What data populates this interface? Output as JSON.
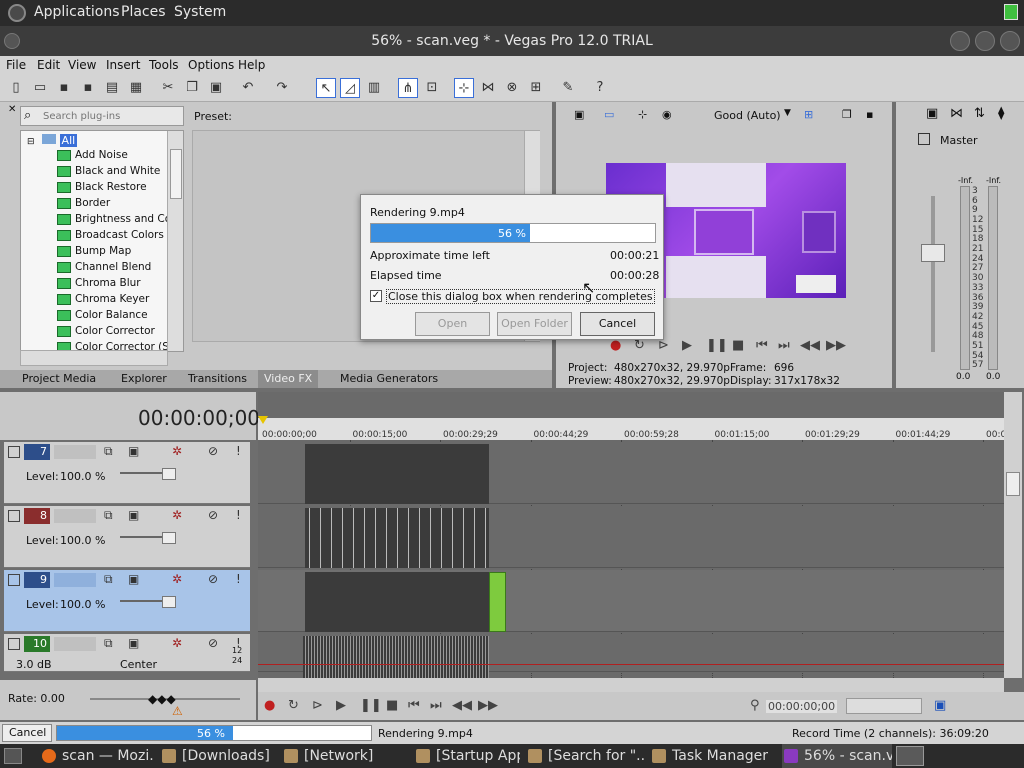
{
  "topbar": {
    "menus": [
      "Applications",
      "Places",
      "System"
    ]
  },
  "window": {
    "title": "56% - scan.veg * - Vegas Pro 12.0 TRIAL"
  },
  "menubar": [
    "File",
    "Edit",
    "View",
    "Insert",
    "Tools",
    "Options",
    "Help"
  ],
  "plugins": {
    "search_placeholder": "Search plug-ins",
    "root": "All",
    "items": [
      "Add Noise",
      "Black and White",
      "Black Restore",
      "Border",
      "Brightness and Con",
      "Broadcast Colors",
      "Bump Map",
      "Channel Blend",
      "Chroma Blur",
      "Chroma Keyer",
      "Color Balance",
      "Color Corrector",
      "Color Corrector (Se"
    ],
    "preset_label": "Preset:"
  },
  "tabs": [
    "Project Media",
    "Explorer",
    "Transitions",
    "Video FX",
    "Media Generators"
  ],
  "preview": {
    "quality": "Good (Auto)",
    "project_label": "Project:",
    "project_value": "480x270x32, 29.970p",
    "preview_label": "Preview:",
    "preview_value": "480x270x32, 29.970p",
    "frame_label": "Frame:",
    "frame_value": "696",
    "display_label": "Display:",
    "display_value": "317x178x32"
  },
  "master": {
    "label": "Master",
    "inf_left": "-Inf.",
    "inf_right": "-Inf.",
    "scale": [
      "3",
      "6",
      "9",
      "12",
      "15",
      "18",
      "21",
      "24",
      "27",
      "30",
      "33",
      "36",
      "39",
      "42",
      "45",
      "48",
      "51",
      "54",
      "57"
    ],
    "bottom_left": "0.0",
    "bottom_right": "0.0"
  },
  "dialog": {
    "rendering": "Rendering 9.mp4",
    "progress_text": "56 %",
    "progress": 0.56,
    "time_left_label": "Approximate time left",
    "time_left": "00:00:21",
    "elapsed_label": "Elapsed time",
    "elapsed": "00:00:28",
    "checkbox_label": "Close this dialog box when rendering completes",
    "open": "Open",
    "open_folder": "Open Folder",
    "cancel": "Cancel"
  },
  "timeline": {
    "timecode": "00:00:00;00",
    "ruler": [
      "00:00:00;00",
      "00:00:15;00",
      "00:00:29;29",
      "00:00:44;29",
      "00:00:59;28",
      "00:01:15;00",
      "00:01:29;29",
      "00:01:44;29",
      "00:0"
    ]
  },
  "tracks": [
    {
      "num": "7",
      "level_label": "Level:",
      "level": "100.0 %"
    },
    {
      "num": "8",
      "level_label": "Level:",
      "level": "100.0 %"
    },
    {
      "num": "9",
      "level_label": "Level:",
      "level": "100.0 %"
    },
    {
      "num": "10",
      "volume": "3.0 dB",
      "pan": "Center",
      "meter_top": "12",
      "meter_bottom": "24"
    }
  ],
  "rate": {
    "label": "Rate: 0.00"
  },
  "transport": {
    "timecode": "00:00:00;00"
  },
  "status": {
    "cancel": "Cancel",
    "progress_text": "56 %",
    "progress": 0.56,
    "rendering": "Rendering 9.mp4",
    "record_time": "Record Time (2 channels): 36:09:20"
  },
  "taskbar": [
    "scan — Mozi...",
    "[Downloads]",
    "[Network]",
    "[Startup App...",
    "[Search for \"...",
    "Task Manager",
    "56% - scan.v..."
  ]
}
